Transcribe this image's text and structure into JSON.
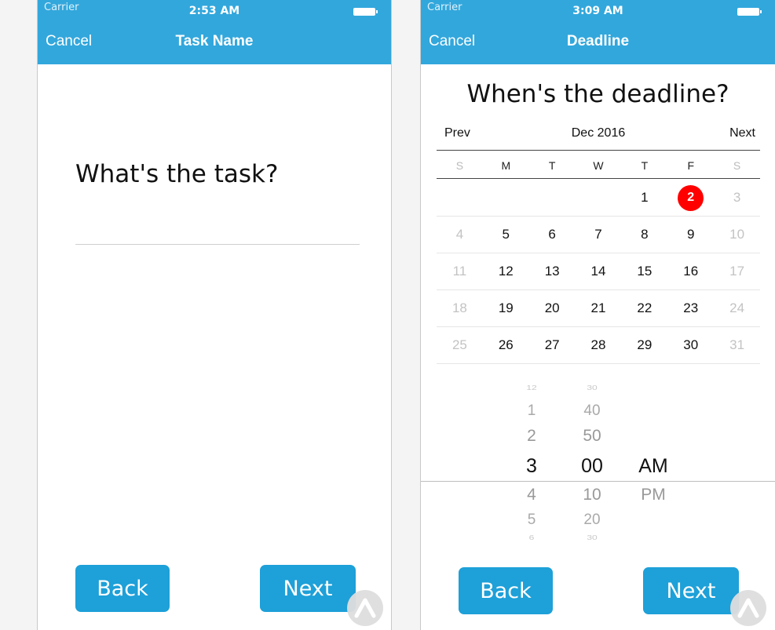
{
  "screen1": {
    "status": {
      "carrier": "Carrier",
      "time": "2:53 AM"
    },
    "nav": {
      "cancel": "Cancel",
      "title": "Task Name"
    },
    "question": "What's the task?",
    "buttons": {
      "back": "Back",
      "next": "Next"
    }
  },
  "screen2": {
    "status": {
      "carrier": "Carrier",
      "time": "3:09 AM"
    },
    "nav": {
      "cancel": "Cancel",
      "title": "Deadline"
    },
    "question": "When's the deadline?",
    "calendar": {
      "prev": "Prev",
      "month": "Dec 2016",
      "next": "Next",
      "weekdays": [
        "S",
        "M",
        "T",
        "W",
        "T",
        "F",
        "S"
      ],
      "weeks": [
        [
          "",
          "",
          "",
          "",
          "1",
          "2",
          "3"
        ],
        [
          "4",
          "5",
          "6",
          "7",
          "8",
          "9",
          "10"
        ],
        [
          "11",
          "12",
          "13",
          "14",
          "15",
          "16",
          "17"
        ],
        [
          "18",
          "19",
          "20",
          "21",
          "22",
          "23",
          "24"
        ],
        [
          "25",
          "26",
          "27",
          "28",
          "29",
          "30",
          "31"
        ]
      ],
      "selected": "2"
    },
    "time_picker": {
      "hours": [
        "12",
        "1",
        "2",
        "3",
        "4",
        "5",
        "6"
      ],
      "minutes": [
        "30",
        "40",
        "50",
        "00",
        "10",
        "20",
        "30"
      ],
      "periods": [
        "",
        "",
        "",
        "AM",
        "PM",
        "",
        ""
      ]
    },
    "buttons": {
      "back": "Back",
      "next": "Next"
    }
  },
  "colors": {
    "nav_bar": "#32a7dc",
    "button": "#1ea0d8",
    "selected_day": "#ff0000"
  }
}
